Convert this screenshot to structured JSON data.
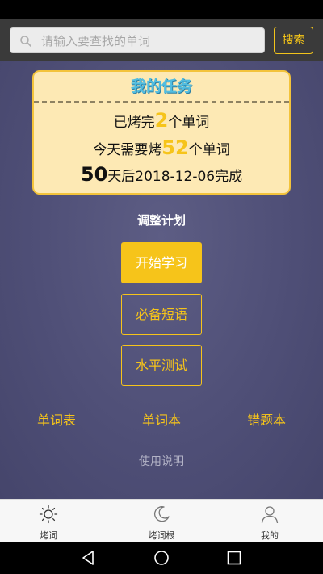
{
  "search": {
    "placeholder": "请输入要查找的单词",
    "button_label": "搜索"
  },
  "task_card": {
    "title": "我的任务",
    "baked_prefix": "已烤完",
    "baked_count": "2",
    "baked_suffix": "个单词",
    "today_prefix": "今天需要烤",
    "today_count": "52",
    "today_suffix": "个单词",
    "days_count": "50",
    "days_suffix": "天后2018-12-06完成"
  },
  "adjust_plan": "调整计划",
  "buttons": {
    "start_study": "开始学习",
    "essential_phrases": "必备短语",
    "level_test": "水平测试"
  },
  "links": {
    "word_list": "单词表",
    "word_book": "单词本",
    "error_book": "错题本"
  },
  "usage_guide": "使用说明",
  "tabs": [
    {
      "label": "烤词",
      "icon": "sun-icon"
    },
    {
      "label": "烤词根",
      "icon": "moon-icon"
    },
    {
      "label": "我的",
      "icon": "user-icon"
    }
  ],
  "colors": {
    "accent": "#f6c41a",
    "background": "#4f4f77",
    "card": "#fde9b4"
  }
}
